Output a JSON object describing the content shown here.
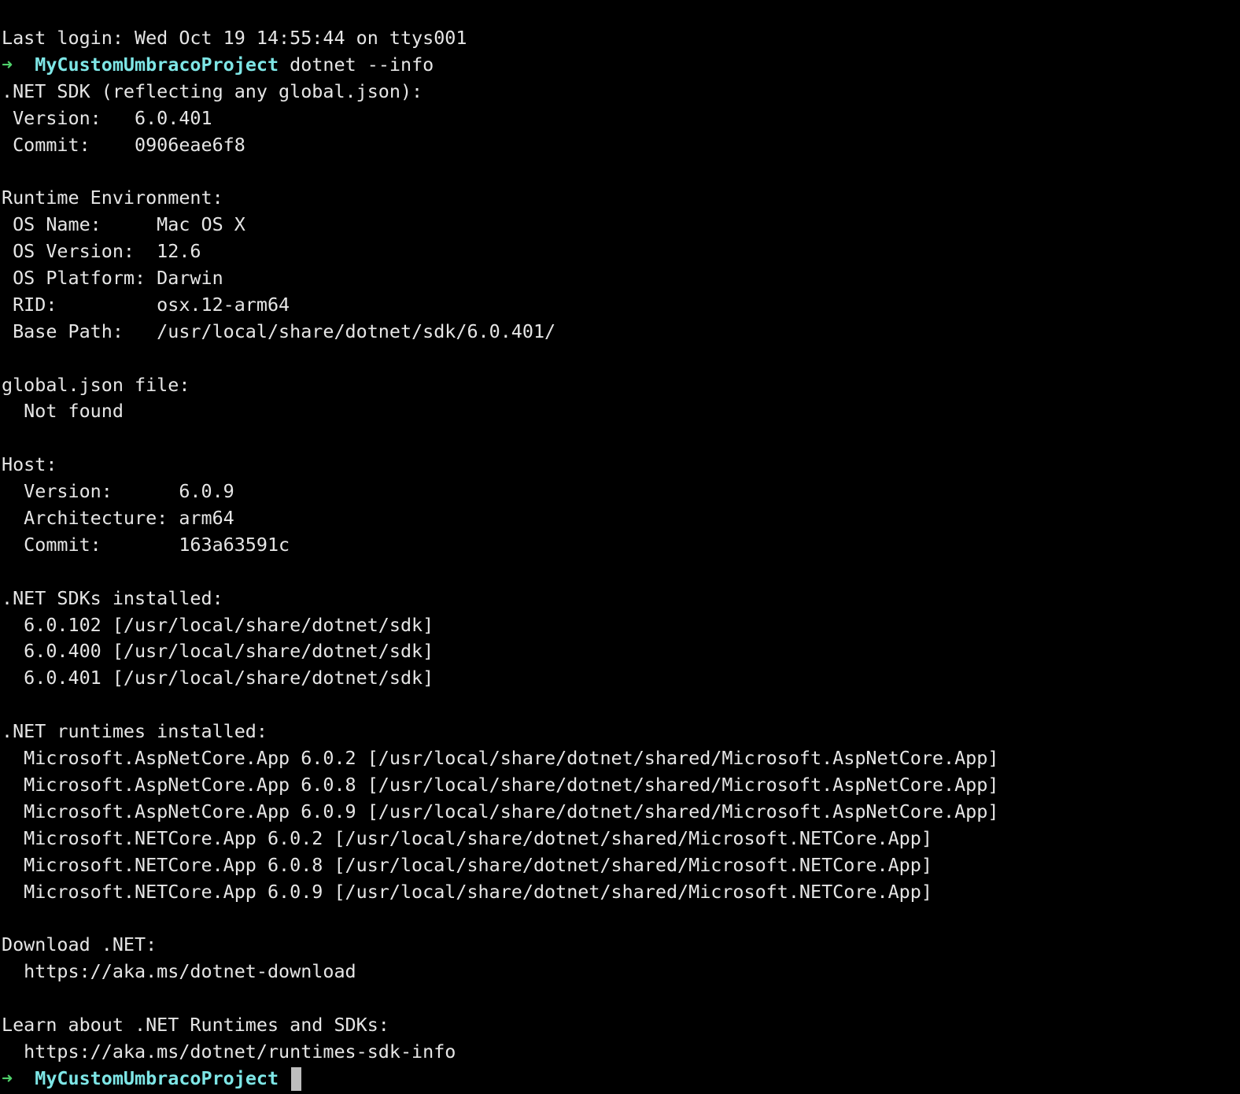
{
  "colors": {
    "background": "#000000",
    "text": "#e6e6e6",
    "prompt_arrow": "#4fd16b",
    "prompt_dir": "#7ee6e6",
    "cursor": "#bdbdbd"
  },
  "prompt": {
    "arrow": "➜",
    "directory": "MyCustomUmbracoProject",
    "command": "dotnet --info"
  },
  "output": {
    "last_login": "Last login: Wed Oct 19 14:55:44 on ttys001",
    "sdk_header": ".NET SDK (reflecting any global.json):",
    "sdk_version": " Version:   6.0.401",
    "sdk_commit": " Commit:    0906eae6f8",
    "runtime_env_header": "Runtime Environment:",
    "os_name": " OS Name:     Mac OS X",
    "os_version": " OS Version:  12.6",
    "os_platform": " OS Platform: Darwin",
    "rid": " RID:         osx.12-arm64",
    "base_path": " Base Path:   /usr/local/share/dotnet/sdk/6.0.401/",
    "global_json_header": "global.json file:",
    "global_json_value": "  Not found",
    "host_header": "Host:",
    "host_version": "  Version:      6.0.9",
    "host_arch": "  Architecture: arm64",
    "host_commit": "  Commit:       163a63591c",
    "sdks_header": ".NET SDKs installed:",
    "sdks": [
      "  6.0.102 [/usr/local/share/dotnet/sdk]",
      "  6.0.400 [/usr/local/share/dotnet/sdk]",
      "  6.0.401 [/usr/local/share/dotnet/sdk]"
    ],
    "runtimes_header": ".NET runtimes installed:",
    "runtimes": [
      "  Microsoft.AspNetCore.App 6.0.2 [/usr/local/share/dotnet/shared/Microsoft.AspNetCore.App]",
      "  Microsoft.AspNetCore.App 6.0.8 [/usr/local/share/dotnet/shared/Microsoft.AspNetCore.App]",
      "  Microsoft.AspNetCore.App 6.0.9 [/usr/local/share/dotnet/shared/Microsoft.AspNetCore.App]",
      "  Microsoft.NETCore.App 6.0.2 [/usr/local/share/dotnet/shared/Microsoft.NETCore.App]",
      "  Microsoft.NETCore.App 6.0.8 [/usr/local/share/dotnet/shared/Microsoft.NETCore.App]",
      "  Microsoft.NETCore.App 6.0.9 [/usr/local/share/dotnet/shared/Microsoft.NETCore.App]"
    ],
    "download_header": "Download .NET:",
    "download_url": "  https://aka.ms/dotnet-download",
    "learn_header": "Learn about .NET Runtimes and SDKs:",
    "learn_url": "  https://aka.ms/dotnet/runtimes-sdk-info"
  }
}
